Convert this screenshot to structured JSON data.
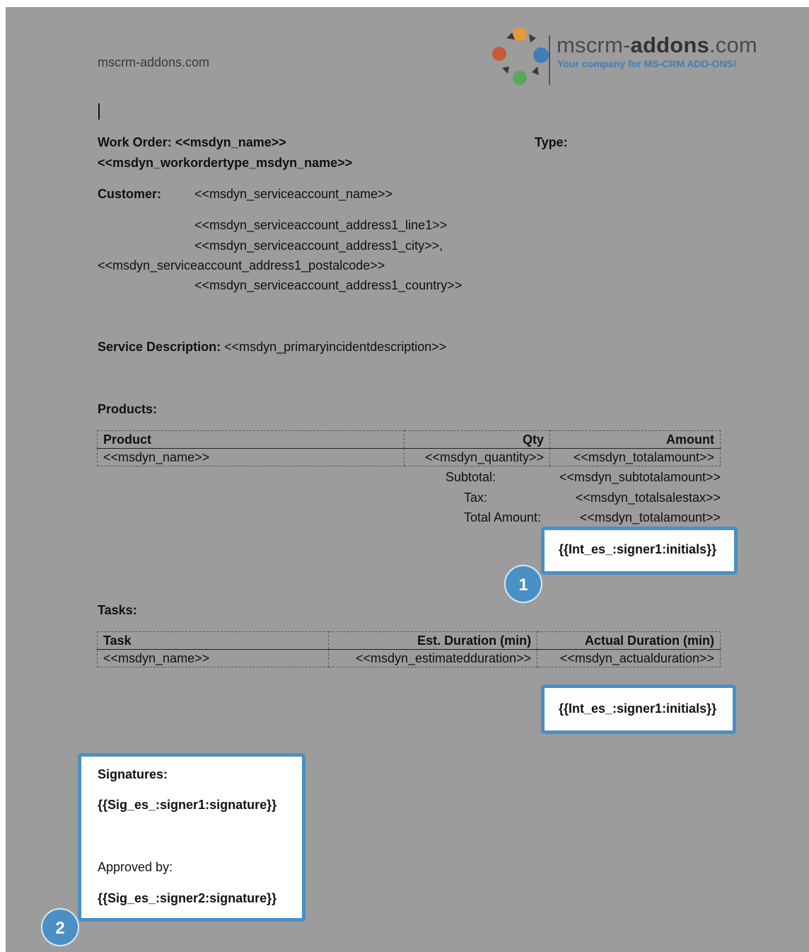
{
  "header": {
    "site": "mscrm-addons.com",
    "logo_main_prefix": "mscrm-",
    "logo_main_bold": "addons",
    "logo_main_suffix": ".com",
    "logo_tagline": "Your company for MS-CRM ADD-ONS!"
  },
  "work_order": {
    "label": "Work Order:",
    "value": "<<msdyn_name>>",
    "type_label": "Type:",
    "type_value": "<<msdyn_workordertype_msdyn_name>>"
  },
  "customer": {
    "label": "Customer:",
    "name": "<<msdyn_serviceaccount_name>>",
    "line1": "<<msdyn_serviceaccount_address1_line1>>",
    "city": "<<msdyn_serviceaccount_address1_city>>,",
    "postalcode": "<<msdyn_serviceaccount_address1_postalcode>>",
    "country": "<<msdyn_serviceaccount_address1_country>>"
  },
  "service": {
    "label": "Service Description:",
    "value": "<<msdyn_primaryincidentdescription>>"
  },
  "products": {
    "title": "Products:",
    "headers": [
      "Product",
      "Qty",
      "Amount"
    ],
    "row": [
      "<<msdyn_name>>",
      "<<msdyn_quantity>>",
      "<<msdyn_totalamount>>"
    ],
    "subtotal_label": "Subtotal:",
    "subtotal_value": "<<msdyn_subtotalamount>>",
    "tax_label": "Tax:",
    "tax_value": "<<msdyn_totalsalestax>>",
    "total_label": "Total Amount:",
    "total_value": "<<msdyn_totalamount>>"
  },
  "tasks": {
    "title": "Tasks:",
    "headers": [
      "Task",
      "Est. Duration (min)",
      "Actual Duration (min)"
    ],
    "row": [
      "<<msdyn_name>>",
      "<<msdyn_estimatedduration>>",
      "<<msdyn_actualduration>>"
    ]
  },
  "callouts": {
    "initials_1": "{{Int_es_:signer1:initials}}",
    "initials_2": "{{Int_es_:signer1:initials}}",
    "badge_1": "1",
    "badge_2": "2",
    "accent_color": "#4a90c4"
  },
  "signatures": {
    "title": "Signatures:",
    "signer1": "{{Sig_es_:signer1:signature}}",
    "approved_label": "Approved by:",
    "signer2": "{{Sig_es_:signer2:signature}}"
  }
}
